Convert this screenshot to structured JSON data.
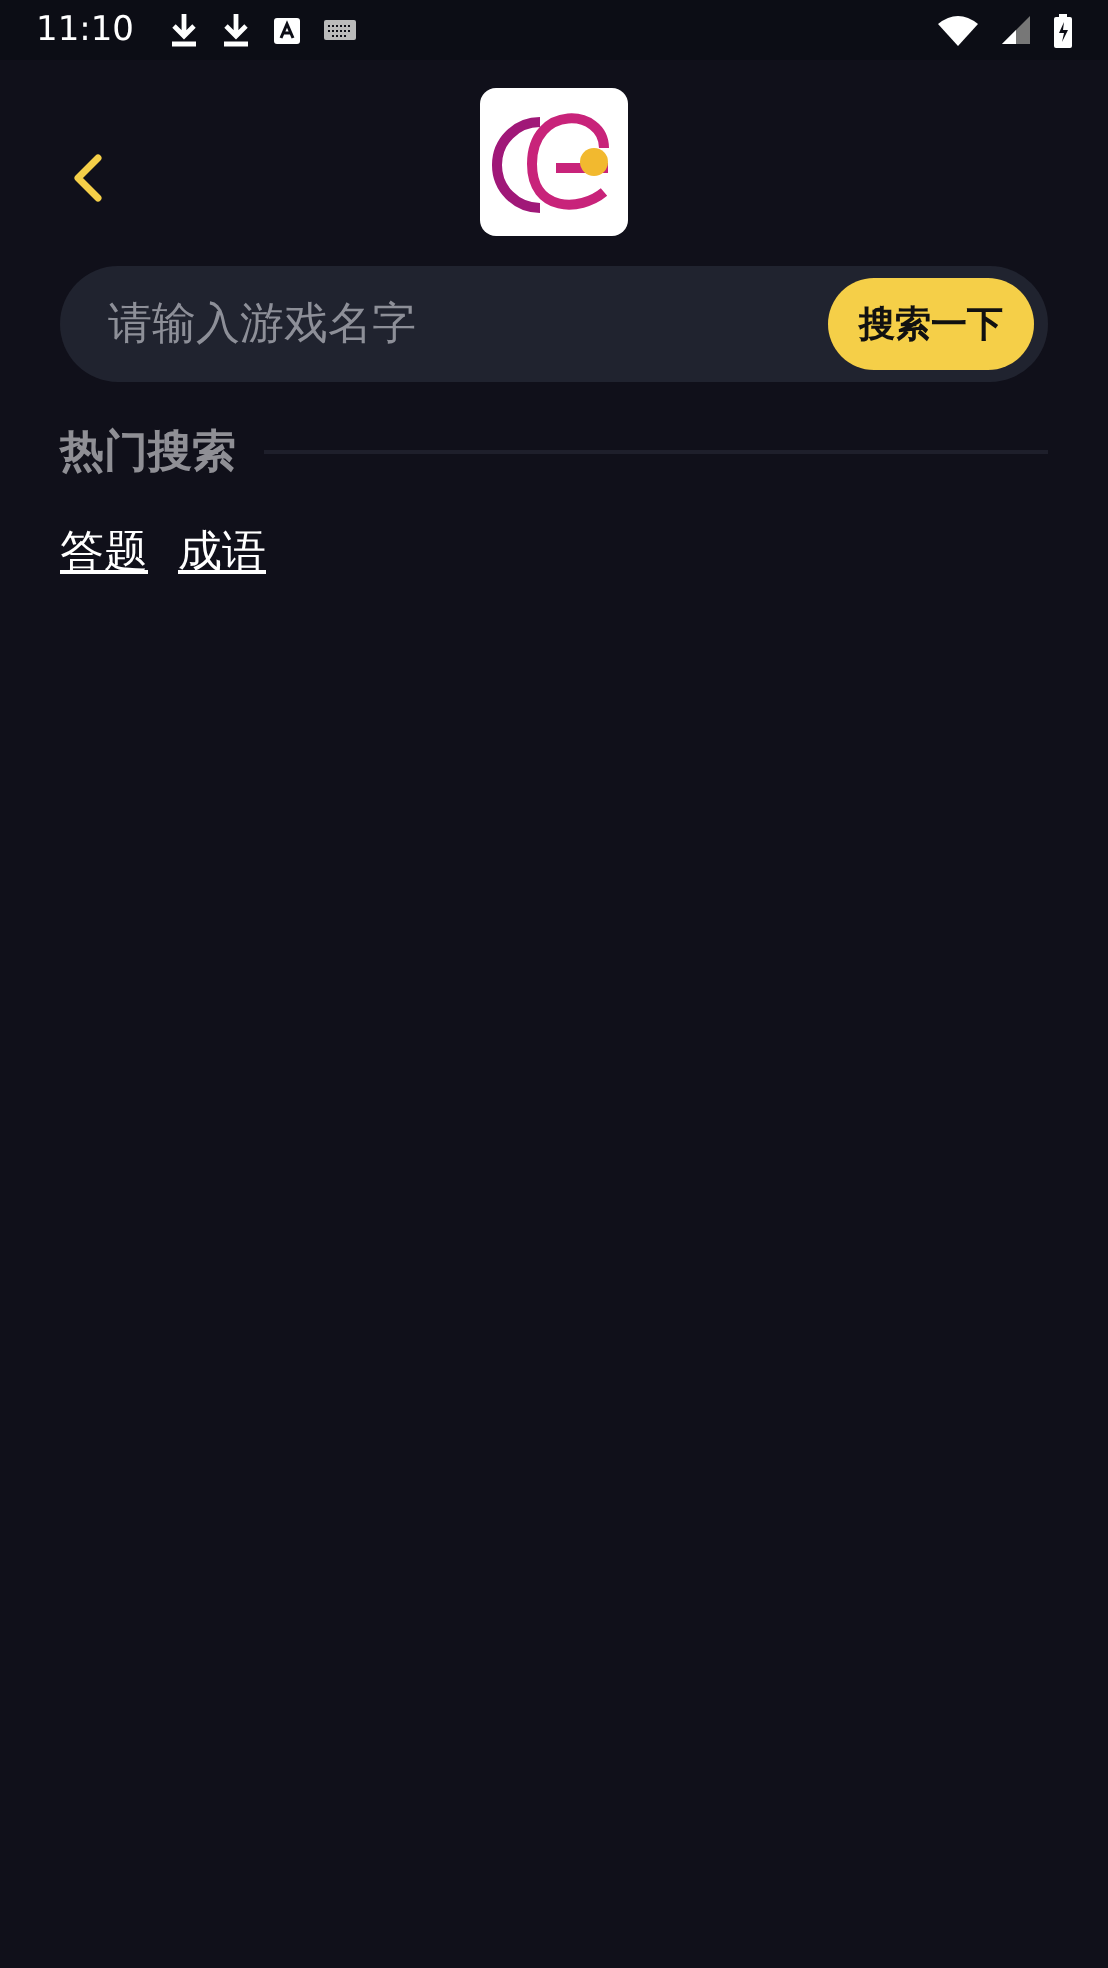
{
  "status_bar": {
    "time": "11:10"
  },
  "search": {
    "placeholder": "请输入游戏名字",
    "button": "搜索一下"
  },
  "hot_search": {
    "title": "热门搜索",
    "tags": [
      "答题",
      "成语"
    ]
  }
}
